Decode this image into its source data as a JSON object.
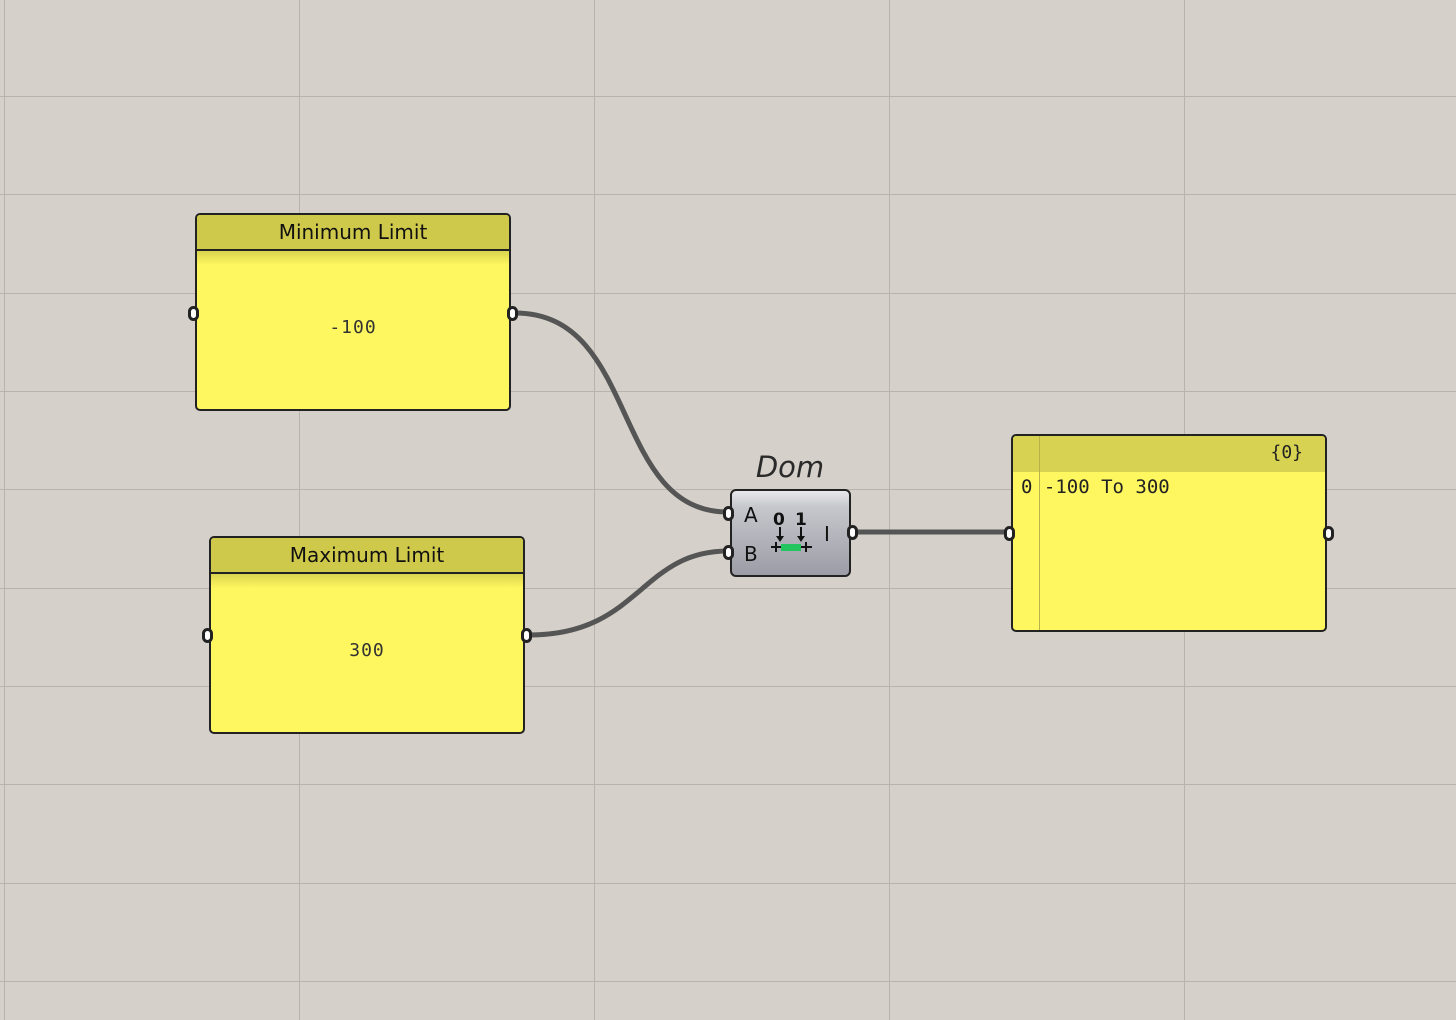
{
  "canvas": {
    "background_color": "#d5d1ca",
    "grid_color": "#b8b4ad",
    "wire_color": "#555555"
  },
  "min_panel": {
    "title": "Minimum Limit",
    "value": "-100"
  },
  "max_panel": {
    "title": "Maximum Limit",
    "value": "300"
  },
  "domain_component": {
    "title": "Dom",
    "input_a": "A",
    "input_b": "B",
    "output_i": "I",
    "icon_label_0": "0",
    "icon_label_1": "1",
    "icon": "domain-icon"
  },
  "output_panel": {
    "path": "{0}",
    "row_index": "0",
    "row_value": "-100 To 300"
  }
}
